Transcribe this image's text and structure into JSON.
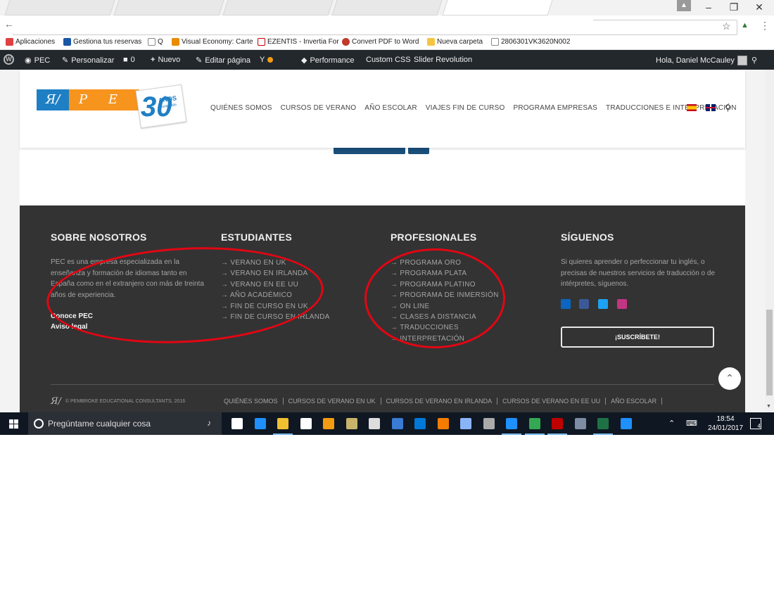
{
  "browser": {
    "bookmarks": [
      {
        "label": "Aplicaciones",
        "color": "#e04040"
      },
      {
        "label": "Gestiona tus reservas",
        "color": "#1a56a8"
      },
      {
        "label": "Q",
        "color": "#888888"
      },
      {
        "label": "Visual Economy: Carte",
        "color": "#e88c00"
      },
      {
        "label": "EZENTIS - Invertia For",
        "color": "#c00000"
      },
      {
        "label": "Convert PDF to Word",
        "color": "#c0392b"
      },
      {
        "label": "Nueva carpeta",
        "color": "#f5c542"
      },
      {
        "label": "2806301VK3620N002",
        "color": "#888888"
      }
    ]
  },
  "wp_admin": {
    "site": "PEC",
    "customize": "Personalizar",
    "comments": "0",
    "new": "Nuevo",
    "edit_page": "Editar página",
    "performance": "Performance",
    "custom_css": "Custom CSS",
    "slider": "Slider Revolution",
    "greeting": "Hola, Daniel McCauley"
  },
  "site_header": {
    "logo_letters": "P E C",
    "logo_years": "30",
    "logo_anos": "AÑOS",
    "logo_since": "desde 1986",
    "nav": [
      "QUIÉNES SOMOS",
      "CURSOS DE VERANO",
      "AÑO ESCOLAR",
      "VIAJES FIN DE CURSO",
      "PROGRAMA EMPRESAS",
      "TRADUCCIONES E INTERPRETACIÓN"
    ]
  },
  "footer": {
    "about": {
      "title": "SOBRE NOSOTROS",
      "text": "PEC es una empresa especializada en la enseñanza y formación de idiomas tanto en España como en el extranjero con más de treinta años de experiencia.",
      "link1": "Conoce PEC",
      "link2": "Aviso legal"
    },
    "students": {
      "title": "ESTUDIANTES",
      "links": [
        "VERANO EN UK",
        "VERANO EN IRLANDA",
        "VERANO EN EE UU",
        "AÑO ACADÉMICO",
        "FIN DE CURSO EN UK",
        "FIN DE CURSO EN IRLANDA"
      ]
    },
    "professionals": {
      "title": "PROFESIONALES",
      "links": [
        "PROGRAMA ORO",
        "PROGRAMA PLATA",
        "PROGRAMA PLATINO",
        "PROGRAMA DE INMERSIÓN",
        "ON LINE",
        "CLASES A DISTANCIA",
        "TRADUCCIONES",
        "INTERPRETACIÓN"
      ]
    },
    "follow": {
      "title": "SÍGUENOS",
      "text": "Si quieres aprender o perfeccionar tu inglés, o precisas de nuestros servicios de traducción o de intérpretes, síguenos.",
      "subscribe": "¡SUSCRÍBETE!",
      "social_icons": [
        {
          "name": "linkedin-icon",
          "color": "#0a66c2",
          "glyph": "in"
        },
        {
          "name": "facebook-icon",
          "color": "#3b5998",
          "glyph": "f"
        },
        {
          "name": "twitter-icon",
          "color": "#1da1f2",
          "glyph": "t"
        },
        {
          "name": "instagram-icon",
          "color": "#c13584",
          "glyph": "◎"
        }
      ]
    },
    "copyright": "© PEMBROKE EDUCATIONAL CONSULTANTS, 2016",
    "bottom_nav": [
      "QUIÉNES SOMOS",
      "CURSOS DE VERANO EN UK",
      "CURSOS DE VERANO EN IRLANDA",
      "CURSOS DE VERANO EN EE UU",
      "AÑO ESCOLAR"
    ]
  },
  "taskbar": {
    "search_placeholder": "Pregúntame cualquier cosa",
    "time": "18:54",
    "date": "24/01/2017",
    "notifications": "4",
    "apps": [
      {
        "name": "task-view-icon",
        "color": "#ffffff"
      },
      {
        "name": "edge-icon",
        "color": "#1e90ff"
      },
      {
        "name": "file-explorer-icon",
        "color": "#f0c030"
      },
      {
        "name": "store-icon",
        "color": "#ffffff"
      },
      {
        "name": "paint-icon",
        "color": "#f39c12"
      },
      {
        "name": "notes-icon",
        "color": "#c9b36a"
      },
      {
        "name": "calculator-icon",
        "color": "#dddddd"
      },
      {
        "name": "photos-icon",
        "color": "#3a7bd5"
      },
      {
        "name": "outlook-icon",
        "color": "#0078d7"
      },
      {
        "name": "vlc-icon",
        "color": "#f57c00"
      },
      {
        "name": "app-icon",
        "color": "#8ab4f8"
      },
      {
        "name": "game-icon",
        "color": "#aaaaaa"
      },
      {
        "name": "ie-icon",
        "color": "#1e90ff"
      },
      {
        "name": "chrome-icon",
        "color": "#34a853"
      },
      {
        "name": "filezilla-icon",
        "color": "#bf0000"
      },
      {
        "name": "settings-app-icon",
        "color": "#7e8ca3"
      },
      {
        "name": "excel-icon",
        "color": "#1e7145"
      },
      {
        "name": "help-icon",
        "color": "#1e90ff"
      }
    ]
  }
}
